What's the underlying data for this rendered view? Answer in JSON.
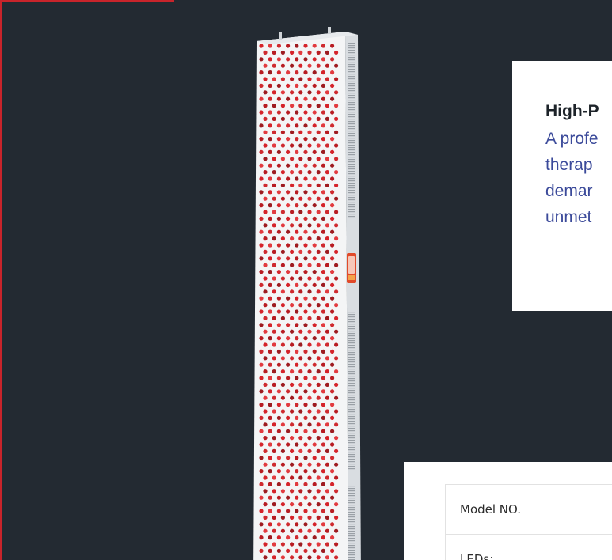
{
  "colors": {
    "background": "#232a32",
    "accent_red": "#c8242b",
    "card_bg": "#ffffff",
    "title_text": "#1d2329",
    "body_text": "#3b4a9a"
  },
  "product": {
    "alt": "Red light therapy panel"
  },
  "info_card": {
    "title": "High-P",
    "lines": [
      "A profe",
      "therap",
      "demar",
      "unmet"
    ]
  },
  "spec_table": {
    "rows": [
      {
        "label": "Model NO."
      },
      {
        "label": "LEDs:"
      }
    ]
  }
}
